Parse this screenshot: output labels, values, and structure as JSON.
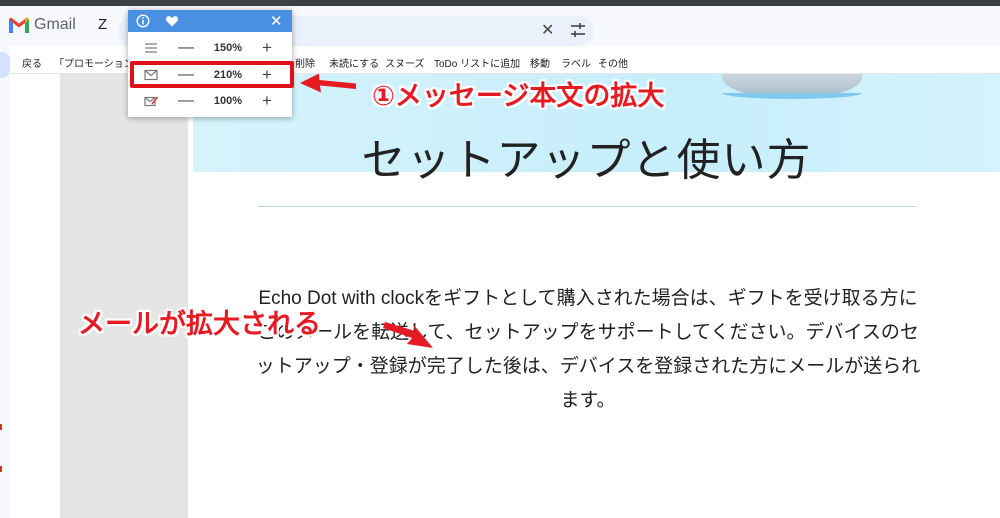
{
  "topbar": {
    "app_name": "Gmail",
    "search_prefix": "Z",
    "clear_symbol": "✕",
    "icons": {
      "logo": "gmail-logo-icon",
      "tune": "tune-icon"
    }
  },
  "toolbar": {
    "items": [
      "戻る",
      "「プロモーション」",
      "削除",
      "未読にする",
      "スヌーズ",
      "ToDo リストに追加",
      "移動",
      "ラベル",
      "その他"
    ]
  },
  "popup": {
    "icons": {
      "info": "info-icon",
      "heart": "heart-icon",
      "close": "close-icon"
    },
    "close_symbol": "✕",
    "minus_symbol": "—",
    "plus_symbol": "+",
    "rows": [
      {
        "icon": "list-icon",
        "value": "150%"
      },
      {
        "icon": "mail-icon",
        "value": "210%"
      },
      {
        "icon": "compose-icon",
        "value": "100%"
      }
    ]
  },
  "email": {
    "heading": "セットアップと使い方",
    "body_lines": [
      "Echo Dot with clockをギフトとして購入された場合は、ギフトを受け取る方に",
      "このメールを転送して、セットアップをサポートしてください。デバイスのセ",
      "ットアップ・登録が完了した後は、デバイスを登録された方にメールが送られ",
      "ます。"
    ]
  },
  "annotations": {
    "message_zoom": "①メッセージ本文の拡大",
    "mail_enlarged": "メールが拡大される"
  },
  "colors": {
    "annotation_red": "#e51b23",
    "popup_header": "#4a90e2",
    "hero_bg": "#c6eefb"
  }
}
